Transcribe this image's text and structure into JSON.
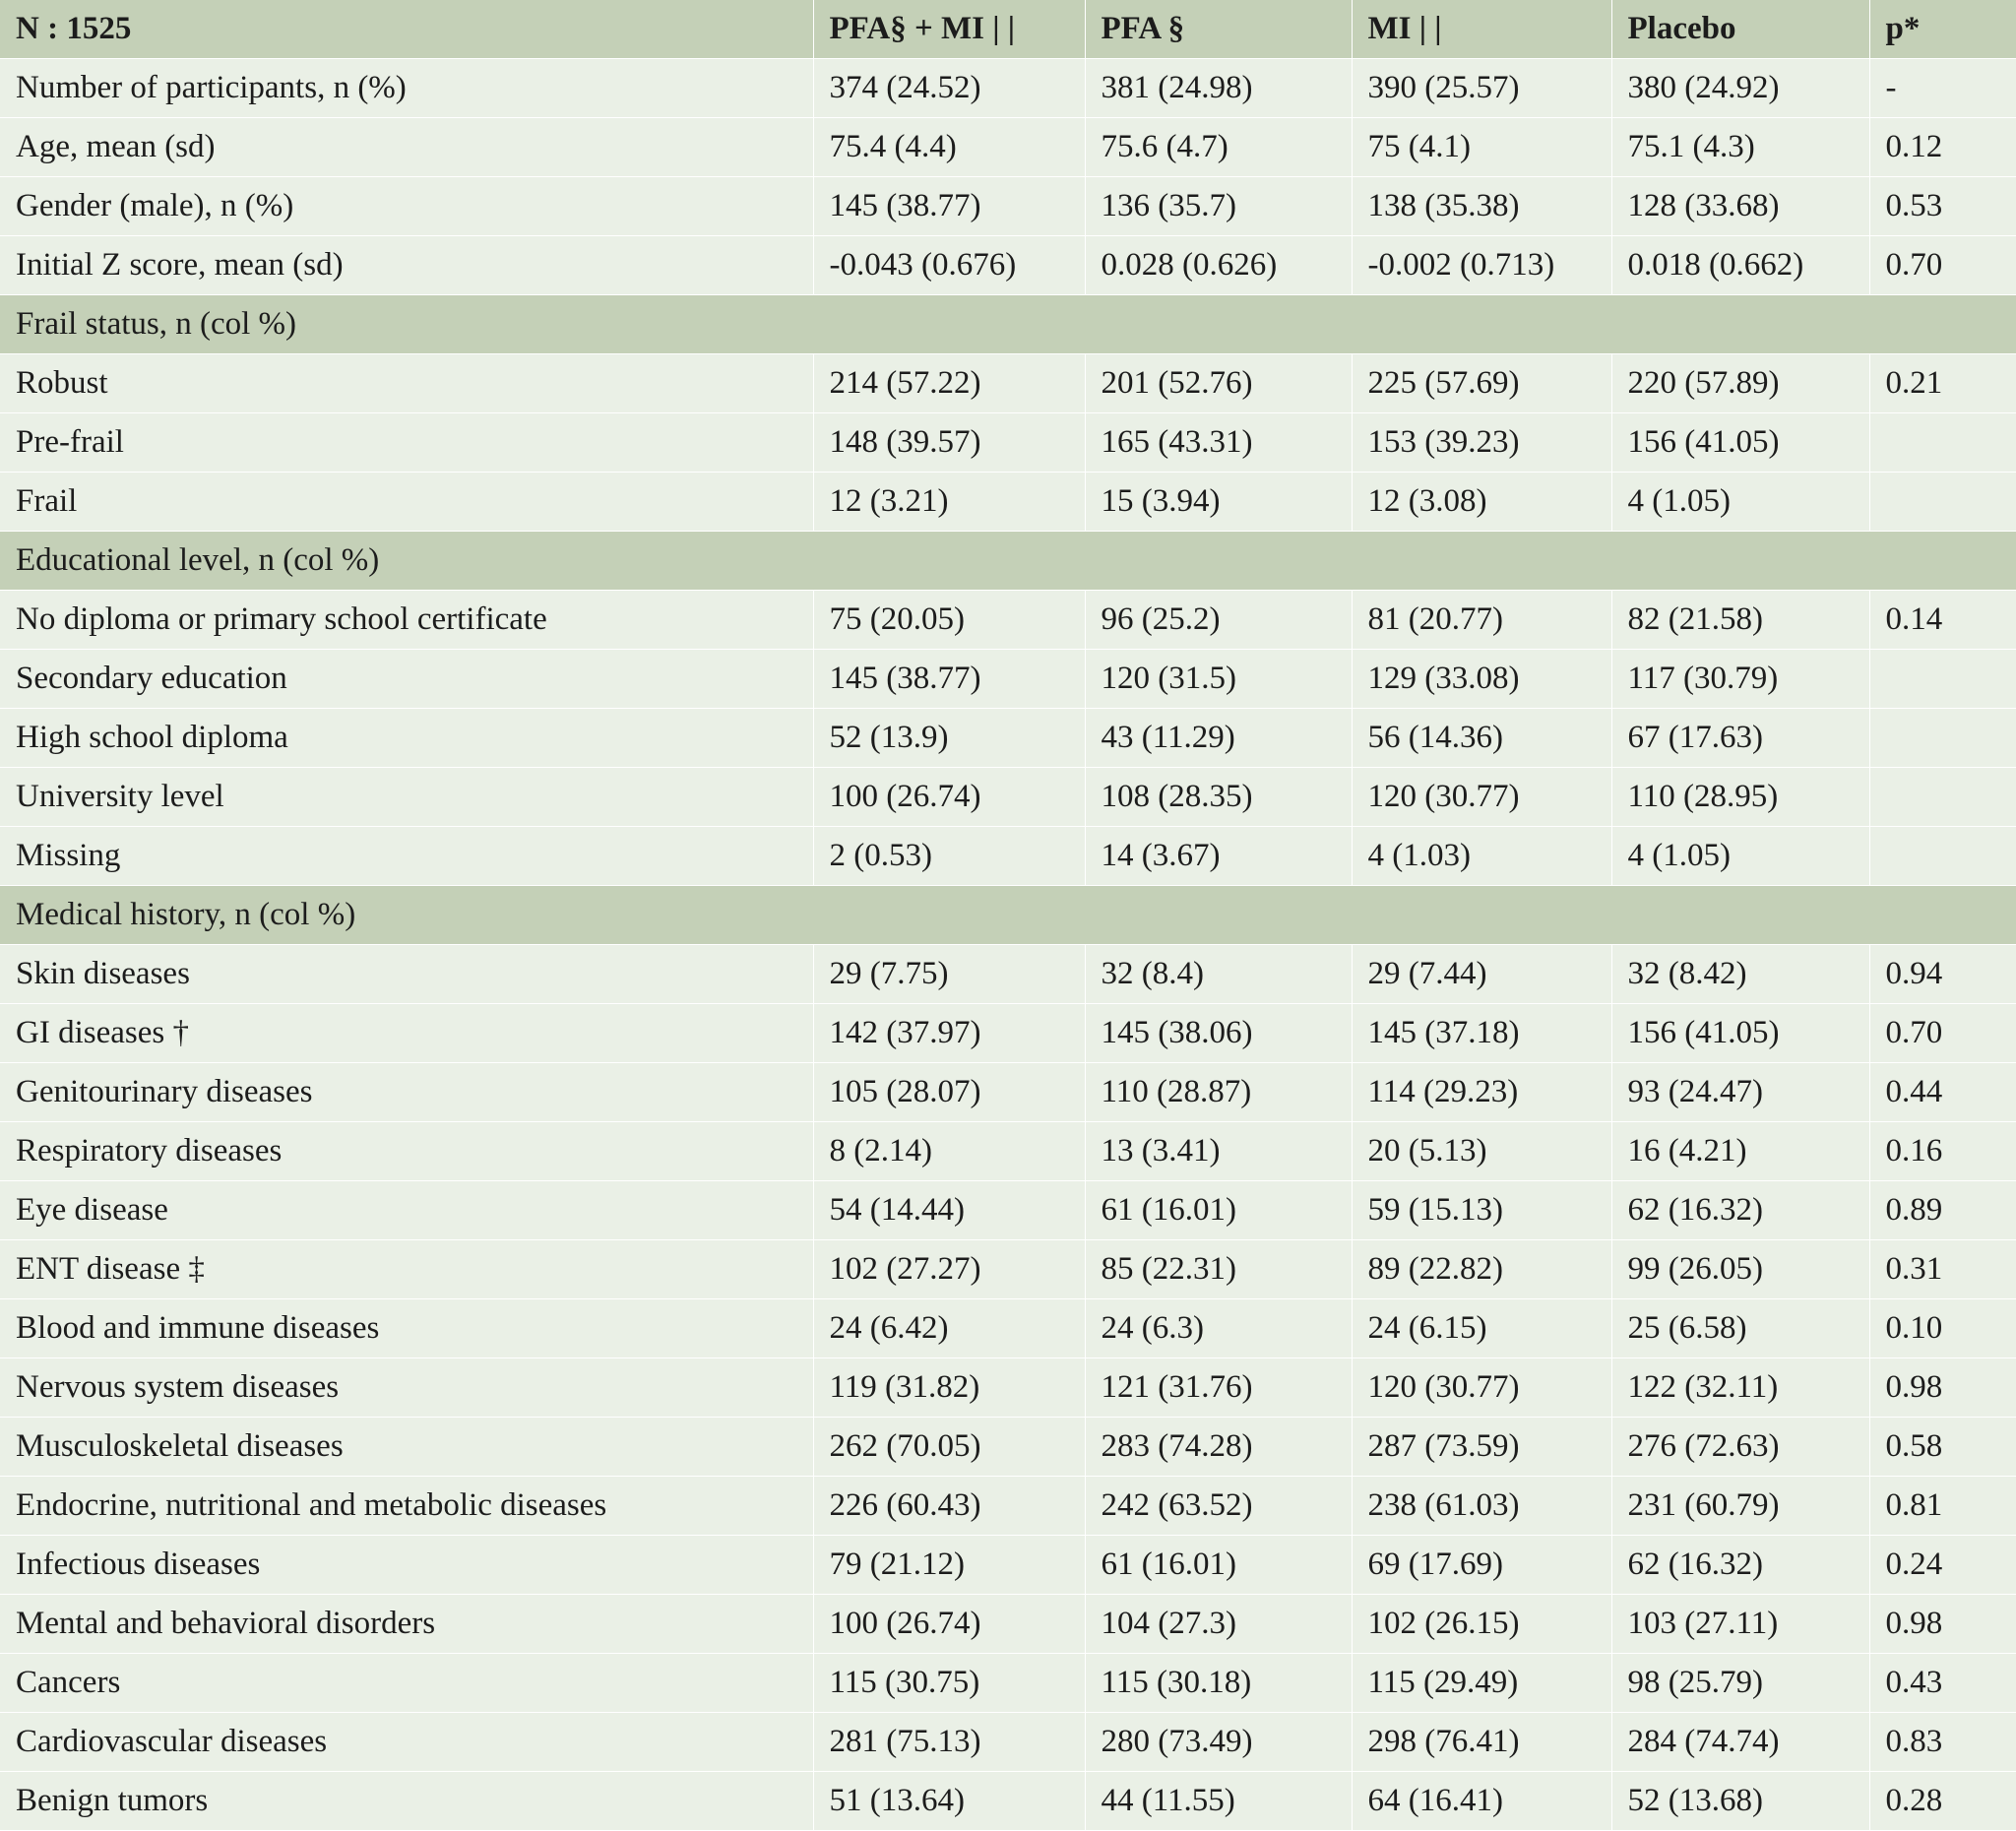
{
  "header": [
    "N : 1525",
    "PFA§ + MI | |",
    "PFA §",
    "MI | |",
    "Placebo",
    "p*"
  ],
  "rows": [
    {
      "type": "data",
      "cells": [
        "Number of participants, n (%)",
        "374 (24.52)",
        "381 (24.98)",
        "390 (25.57)",
        "380 (24.92)",
        "-"
      ]
    },
    {
      "type": "data",
      "cells": [
        "Age, mean (sd)",
        "75.4 (4.4)",
        "75.6 (4.7)",
        "75 (4.1)",
        "75.1 (4.3)",
        "0.12"
      ]
    },
    {
      "type": "data",
      "cells": [
        "Gender (male), n (%)",
        "145 (38.77)",
        "136 (35.7)",
        "138 (35.38)",
        "128 (33.68)",
        "0.53"
      ]
    },
    {
      "type": "data",
      "cells": [
        "Initial Z score, mean (sd)",
        "-0.043 (0.676)",
        "0.028 (0.626)",
        "-0.002 (0.713)",
        "0.018 (0.662)",
        "0.70"
      ]
    },
    {
      "type": "section",
      "label": "Frail status, n (col %)"
    },
    {
      "type": "data",
      "cells": [
        "Robust",
        "214 (57.22)",
        "201 (52.76)",
        "225 (57.69)",
        "220 (57.89)",
        "0.21"
      ]
    },
    {
      "type": "data",
      "cells": [
        "Pre-frail",
        "148 (39.57)",
        "165 (43.31)",
        "153 (39.23)",
        "156 (41.05)",
        ""
      ]
    },
    {
      "type": "data",
      "cells": [
        "Frail",
        "12 (3.21)",
        "15 (3.94)",
        "12 (3.08)",
        "4 (1.05)",
        ""
      ]
    },
    {
      "type": "section",
      "label": "Educational level, n (col %)"
    },
    {
      "type": "data",
      "cells": [
        "No diploma or primary school certificate",
        "75 (20.05)",
        "96 (25.2)",
        "81 (20.77)",
        "82 (21.58)",
        "0.14"
      ]
    },
    {
      "type": "data",
      "cells": [
        "Secondary education",
        "145 (38.77)",
        "120 (31.5)",
        "129 (33.08)",
        "117 (30.79)",
        ""
      ]
    },
    {
      "type": "data",
      "cells": [
        "High school diploma",
        "52 (13.9)",
        "43 (11.29)",
        "56 (14.36)",
        "67 (17.63)",
        ""
      ]
    },
    {
      "type": "data",
      "cells": [
        "University level",
        "100 (26.74)",
        "108 (28.35)",
        "120 (30.77)",
        "110 (28.95)",
        ""
      ]
    },
    {
      "type": "data",
      "cells": [
        "Missing",
        "2 (0.53)",
        "14 (3.67)",
        "4 (1.03)",
        "4 (1.05)",
        ""
      ]
    },
    {
      "type": "section",
      "label": "Medical history, n (col %)"
    },
    {
      "type": "data",
      "cells": [
        "Skin diseases",
        "29 (7.75)",
        "32 (8.4)",
        "29 (7.44)",
        "32 (8.42)",
        "0.94"
      ]
    },
    {
      "type": "data",
      "cells": [
        "GI diseases †",
        "142 (37.97)",
        "145 (38.06)",
        "145 (37.18)",
        "156 (41.05)",
        "0.70"
      ]
    },
    {
      "type": "data",
      "cells": [
        "Genitourinary diseases",
        "105 (28.07)",
        "110 (28.87)",
        "114 (29.23)",
        "93 (24.47)",
        "0.44"
      ]
    },
    {
      "type": "data",
      "cells": [
        "Respiratory diseases",
        "8 (2.14)",
        "13 (3.41)",
        "20 (5.13)",
        "16 (4.21)",
        "0.16"
      ]
    },
    {
      "type": "data",
      "cells": [
        "Eye disease",
        "54 (14.44)",
        "61 (16.01)",
        "59 (15.13)",
        "62 (16.32)",
        "0.89"
      ]
    },
    {
      "type": "data",
      "cells": [
        "ENT disease ‡",
        "102 (27.27)",
        "85 (22.31)",
        "89 (22.82)",
        "99 (26.05)",
        "0.31"
      ]
    },
    {
      "type": "data",
      "cells": [
        "Blood and immune diseases",
        "24 (6.42)",
        "24 (6.3)",
        "24 (6.15)",
        "25 (6.58)",
        "0.10"
      ]
    },
    {
      "type": "data",
      "cells": [
        "Nervous system diseases",
        "119 (31.82)",
        "121 (31.76)",
        "120 (30.77)",
        "122 (32.11)",
        "0.98"
      ]
    },
    {
      "type": "data",
      "cells": [
        "Musculoskeletal diseases",
        "262 (70.05)",
        "283 (74.28)",
        "287 (73.59)",
        "276 (72.63)",
        "0.58"
      ]
    },
    {
      "type": "data",
      "cells": [
        "Endocrine, nutritional and metabolic diseases",
        "226 (60.43)",
        "242 (63.52)",
        "238 (61.03)",
        "231 (60.79)",
        "0.81"
      ]
    },
    {
      "type": "data",
      "cells": [
        "Infectious diseases",
        "79 (21.12)",
        "61 (16.01)",
        "69 (17.69)",
        "62 (16.32)",
        "0.24"
      ]
    },
    {
      "type": "data",
      "cells": [
        "Mental and behavioral disorders",
        "100 (26.74)",
        "104 (27.3)",
        "102 (26.15)",
        "103 (27.11)",
        "0.98"
      ]
    },
    {
      "type": "data",
      "cells": [
        "Cancers",
        "115 (30.75)",
        "115 (30.18)",
        "115 (29.49)",
        "98 (25.79)",
        "0.43"
      ]
    },
    {
      "type": "data",
      "cells": [
        "Cardiovascular diseases",
        "281 (75.13)",
        "280 (73.49)",
        "298 (76.41)",
        "284 (74.74)",
        "0.83"
      ]
    },
    {
      "type": "data",
      "cells": [
        "Benign tumors",
        "51 (13.64)",
        "44 (11.55)",
        "64 (16.41)",
        "52 (13.68)",
        "0.28"
      ]
    }
  ]
}
